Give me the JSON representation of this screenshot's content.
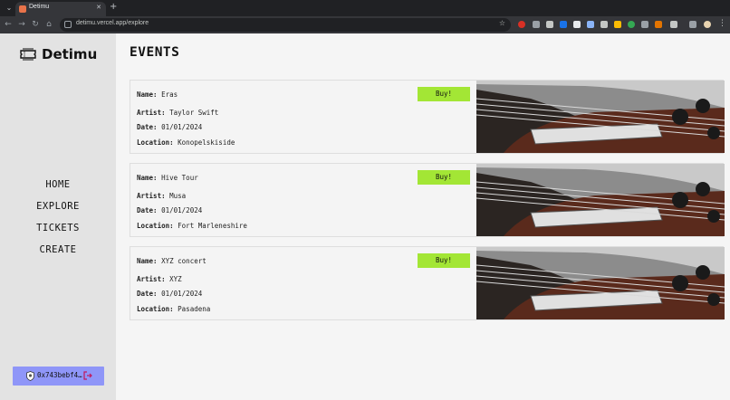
{
  "browser": {
    "tab_title": "Detimu",
    "url": "detimu.vercel.app/explore"
  },
  "app": {
    "brand": "Detimu",
    "nav": [
      "HOME",
      "EXPLORE",
      "TICKETS",
      "CREATE"
    ],
    "wallet_address": "0x743bebf4…",
    "page_title": "EVENTS",
    "labels": {
      "name": "Name:",
      "artist": "Artist:",
      "date": "Date:",
      "location": "Location:"
    },
    "buy_label": "Buy!",
    "events": [
      {
        "name": "Eras",
        "artist": "Taylor Swift",
        "date": "01/01/2024",
        "location": "Konopelskiside"
      },
      {
        "name": "Hive Tour",
        "artist": "Musa",
        "date": "01/01/2024",
        "location": "Fort Marleneshire"
      },
      {
        "name": "XYZ concert",
        "artist": "XYZ",
        "date": "01/01/2024",
        "location": "Pasadena"
      }
    ],
    "accent_button": "#a3e635",
    "wallet_color": "#8f96f8"
  }
}
